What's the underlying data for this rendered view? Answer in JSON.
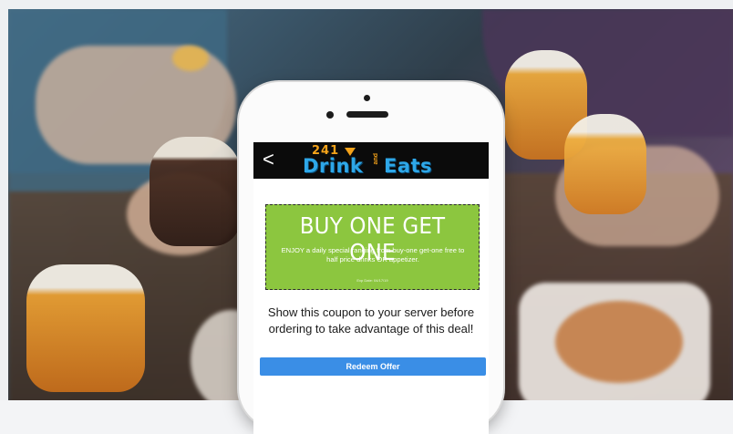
{
  "app": {
    "logo_number": "241",
    "logo_word1": "Drink",
    "logo_and": "and",
    "logo_word2": "Eats",
    "back_glyph": "<"
  },
  "coupon": {
    "title": "BUY ONE GET ONE",
    "description": "ENJOY a daily special ranging from buy-one get-one free to half price drinks OR appetizer.",
    "expiry": "Exp Date: 04/17/19",
    "background_color": "#8cc63f"
  },
  "instructions": "Show this coupon to your server before ordering to take advantage of this deal!",
  "actions": {
    "redeem_label": "Redeem Offer",
    "redeem_color": "#3a8ee6"
  }
}
